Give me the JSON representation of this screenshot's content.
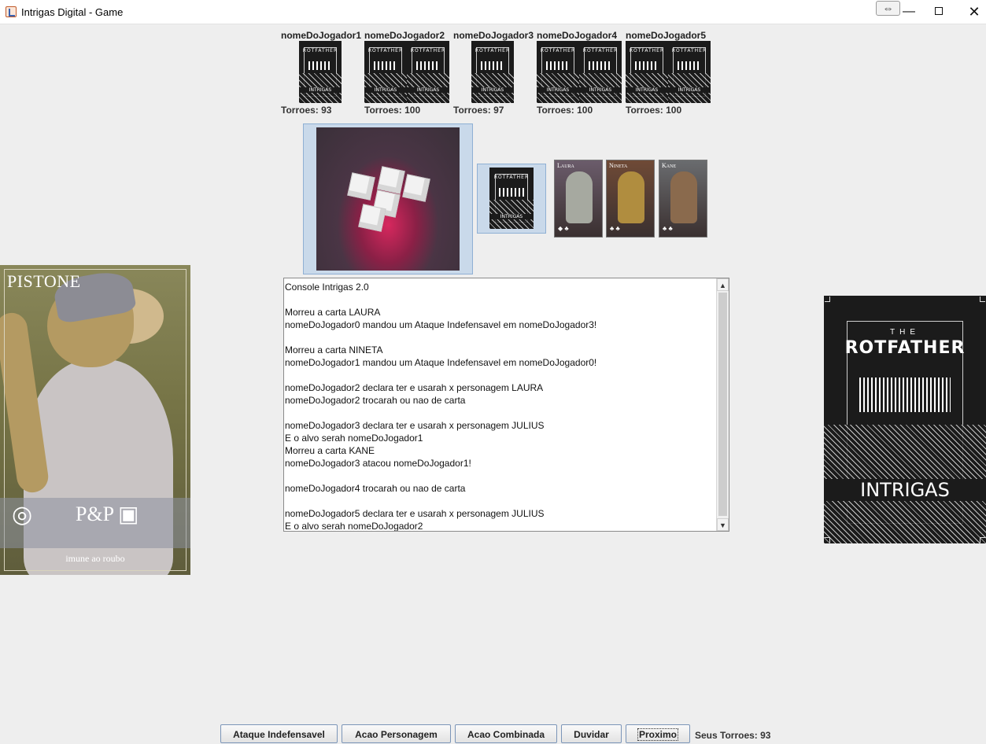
{
  "window": {
    "title": "Intrigas Digital - Game",
    "resize_icon": "⇔",
    "min_icon": "—",
    "close_icon": "✕"
  },
  "players": [
    {
      "name": "nomeDoJogador1",
      "torroes": "Torroes: 93"
    },
    {
      "name": "nomeDoJogador2",
      "torroes": "Torroes: 100"
    },
    {
      "name": "nomeDoJogador3",
      "torroes": "Torroes: 97"
    },
    {
      "name": "nomeDoJogador4",
      "torroes": "Torroes: 100"
    },
    {
      "name": "nomeDoJogador5",
      "torroes": "Torroes: 100"
    }
  ],
  "card_back": {
    "the": "THE",
    "rotfather": "ROTFATHER",
    "intrigas": "INTRIGAS"
  },
  "revealed_cards": [
    {
      "name": "LAURA",
      "initial": "L",
      "rest": "AURA",
      "color": "#6b5c6b",
      "figure_color": "#a6a9a0"
    },
    {
      "name": "NINETA",
      "initial": "N",
      "rest": "INETA",
      "color": "#6f4a36",
      "figure_color": "#b08d3f"
    },
    {
      "name": "KANE",
      "initial": "K",
      "rest": "ANE",
      "color": "#6a6c6f",
      "figure_color": "#8a6a4d"
    }
  ],
  "console": {
    "lines": [
      "Console Intrigas 2.0",
      "",
      "Morreu a carta LAURA",
      "nomeDoJogador0 mandou um Ataque Indefensavel em nomeDoJogador3!",
      "",
      "Morreu a carta NINETA",
      "nomeDoJogador1 mandou um Ataque Indefensavel em nomeDoJogador0!",
      "",
      "nomeDoJogador2 declara ter e usarah x personagem LAURA",
      "nomeDoJogador2 trocarah ou nao de carta",
      "",
      "nomeDoJogador3 declara ter e usarah x personagem JULIUS",
      "E o alvo serah nomeDoJogador1",
      "Morreu a carta KANE",
      "nomeDoJogador3 atacou nomeDoJogador1!",
      "",
      "nomeDoJogador4 trocarah ou nao de carta",
      "",
      "nomeDoJogador5 declara ter e usarah x personagem JULIUS",
      "E o alvo serah nomeDoJogador2"
    ],
    "scroll_up": "▲",
    "scroll_down": "▼"
  },
  "my_card": {
    "title": "PISTONE",
    "initials": "P&P",
    "caption": "imune ao roubo"
  },
  "buttons": {
    "ataque": "Ataque Indefensavel",
    "acao_personagem": "Acao Personagem",
    "acao_combinada": "Acao Combinada",
    "duvidar": "Duvidar",
    "proximo": "Proximo"
  },
  "seus_torroes": "Seus Torroes: 93",
  "colors": {
    "button_border": "#7b95b8",
    "selection": "#c9d9ea"
  }
}
